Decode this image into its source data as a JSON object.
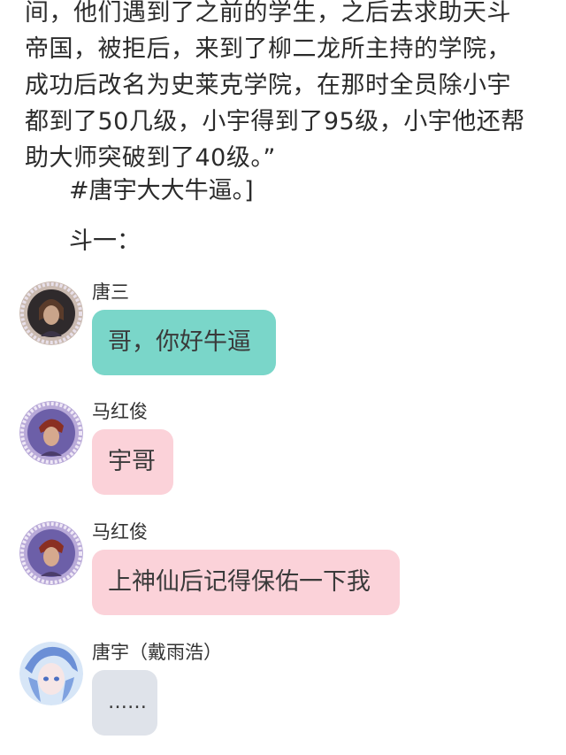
{
  "article": {
    "lines": [
      "间，他们遇到了之前的学生，之后去求助天斗",
      "帝国，被拒后，来到了柳二龙所主持的学院，",
      "成功后改名为史莱克学院，在那时全员除小宇",
      "都到了50几级，小宇得到了95级，小宇他还帮",
      "助大师突破到了40级。”"
    ],
    "hashtag_line": "#唐宇大大牛逼。]",
    "speaker_line": "斗一："
  },
  "chat": {
    "messages": [
      {
        "sender": "唐三",
        "text": "哥，你好牛逼",
        "bubble_color": "#7ad6c9",
        "avatar_icon": "tang-san-avatar-icon"
      },
      {
        "sender": "马红俊",
        "text": "宇哥",
        "bubble_color": "#fbd2d9",
        "avatar_icon": "ma-hongjun-avatar-icon"
      },
      {
        "sender": "马红俊",
        "text": "上神仙后记得保佑一下我",
        "bubble_color": "#fbd2d9",
        "avatar_icon": "ma-hongjun-avatar-icon"
      },
      {
        "sender": "唐宇（戴雨浩）",
        "text": "……",
        "bubble_color": "#dfe3ea",
        "avatar_icon": "tang-yu-avatar-icon"
      }
    ]
  }
}
